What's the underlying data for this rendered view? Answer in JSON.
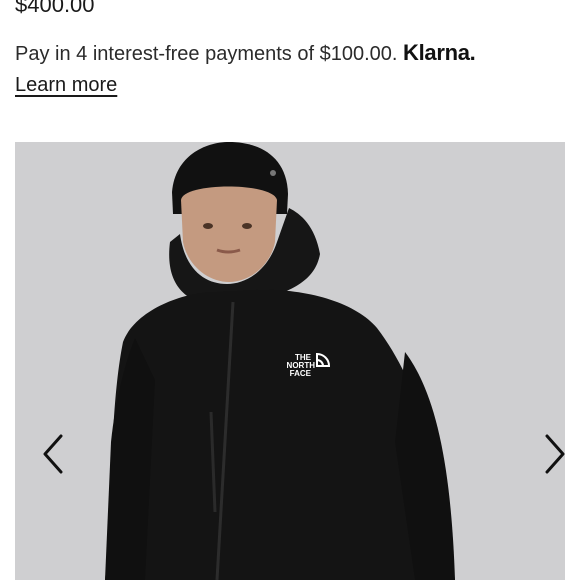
{
  "product": {
    "price": "$400.00"
  },
  "klarna": {
    "message": "Pay in 4 interest-free payments of $100.00.",
    "brand": "Klarna.",
    "learn_more": "Learn more"
  },
  "gallery": {
    "image_logo_text": [
      "THE",
      "NORTH",
      "FACE"
    ],
    "prev_icon": "chevron-left-icon",
    "next_icon": "chevron-right-icon"
  },
  "colors": {
    "background": "#ffffff",
    "photo_background": "#cfcfd1",
    "jacket": "#141414",
    "text": "#1a1a1a"
  }
}
